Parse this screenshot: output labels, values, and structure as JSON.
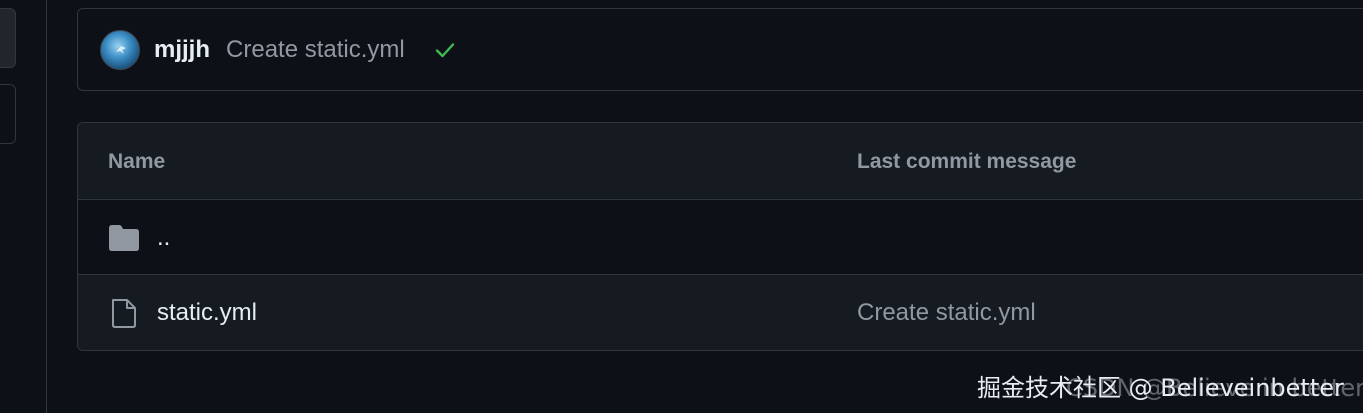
{
  "commit": {
    "author": "mjjjh",
    "message": "Create static.yml",
    "status_icon": "check-icon",
    "status_color": "#3fb950"
  },
  "table": {
    "headers": {
      "name": "Name",
      "last_commit_message": "Last commit message"
    },
    "rows": [
      {
        "type": "folder",
        "icon": "folder-icon",
        "name": "..",
        "message": ""
      },
      {
        "type": "file",
        "icon": "file-icon",
        "name": "static.yml",
        "message": "Create static.yml"
      }
    ]
  },
  "watermark": {
    "text": "掘金技术社区 @ Believeinbetter",
    "ghost": "CSDN @Believe in better"
  },
  "colors": {
    "background": "#0d1117",
    "header_background": "#161b22",
    "border": "#30363d",
    "muted_text": "#9198a1",
    "primary_text": "#e6edf3"
  }
}
